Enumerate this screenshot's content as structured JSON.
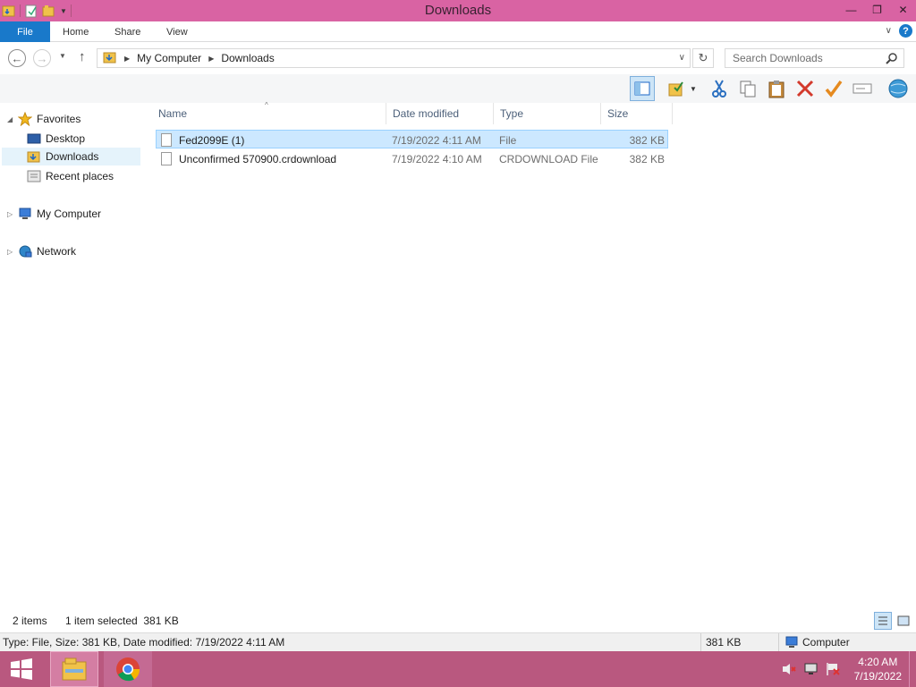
{
  "window": {
    "title": "Downloads",
    "controls": {
      "minimize": "—",
      "restore": "❐",
      "close": "✕"
    }
  },
  "ribbon": {
    "tabs": [
      "File",
      "Home",
      "Share",
      "View"
    ]
  },
  "address": {
    "crumbs": [
      "My Computer",
      "Downloads"
    ],
    "search_placeholder": "Search Downloads"
  },
  "navpane": {
    "favorites_label": "Favorites",
    "favorites": [
      "Desktop",
      "Downloads",
      "Recent places"
    ],
    "my_computer": "My Computer",
    "network": "Network"
  },
  "filelist": {
    "columns": [
      "Name",
      "Date modified",
      "Type",
      "Size"
    ],
    "rows": [
      {
        "name": "Fed2099E (1)",
        "date": "7/19/2022 4:11 AM",
        "type": "File",
        "size": "382 KB",
        "selected": true
      },
      {
        "name": "Unconfirmed 570900.crdownload",
        "date": "7/19/2022 4:10 AM",
        "type": "CRDOWNLOAD File",
        "size": "382 KB",
        "selected": false
      }
    ]
  },
  "statusbar": {
    "item_count": "2 items",
    "selection": "1 item selected  381 KB"
  },
  "details": {
    "info": "Type: File, Size: 381 KB, Date modified: 7/19/2022 4:11 AM",
    "size": "381 KB",
    "location": "Computer"
  },
  "taskbar": {
    "time": "4:20 AM",
    "date": "7/19/2022"
  },
  "colors": {
    "titlebar": "#d963a3",
    "file_tab": "#1979ca",
    "selection": "#cce8ff",
    "taskbar": "#b9587f"
  }
}
